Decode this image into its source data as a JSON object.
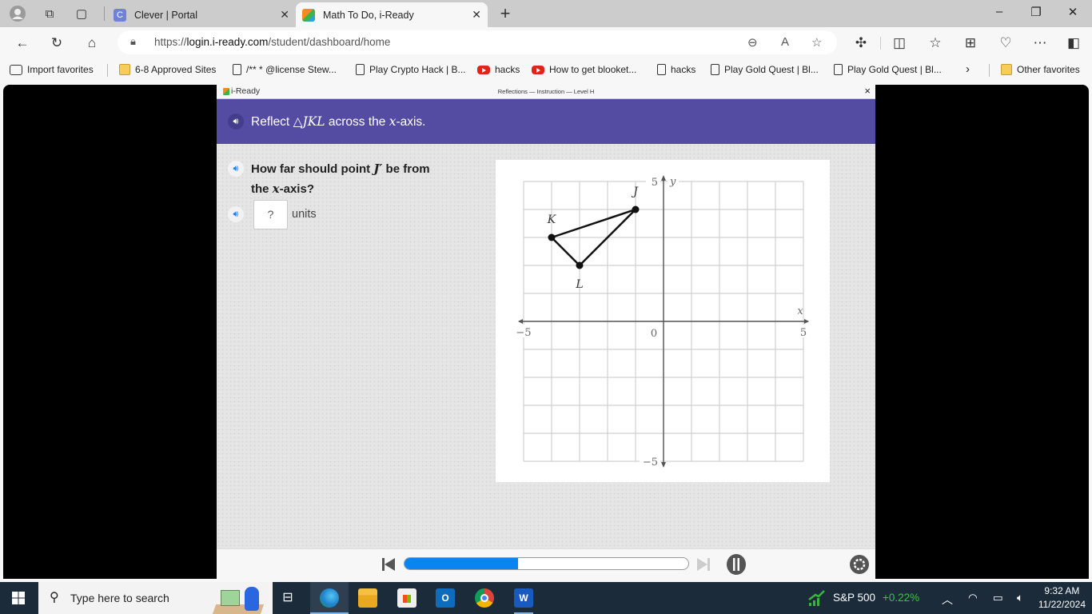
{
  "browser": {
    "tabs": [
      {
        "title": "Clever | Portal",
        "favicon": "clever-icon",
        "active": false
      },
      {
        "title": "Math To Do, i-Ready",
        "favicon": "iready-icon",
        "active": true
      }
    ],
    "url_prefix": "https://",
    "url_domain": "login.i-ready.com",
    "url_path": "/student/dashboard/home",
    "favorites": [
      {
        "label": "Import favorites",
        "icon": "import-icon"
      },
      {
        "label": "6-8 Approved Sites",
        "icon": "folder-icon"
      },
      {
        "label": "/** * @license Stew...",
        "icon": "page-icon"
      },
      {
        "label": "Play Crypto Hack | B...",
        "icon": "page-icon"
      },
      {
        "label": "hacks",
        "icon": "youtube-icon"
      },
      {
        "label": "How to get blooket...",
        "icon": "youtube-icon"
      },
      {
        "label": "hacks",
        "icon": "page-icon"
      },
      {
        "label": "Play Gold Quest | Bl...",
        "icon": "page-icon"
      },
      {
        "label": "Play Gold Quest | Bl...",
        "icon": "page-icon"
      }
    ],
    "other_favorites": "Other favorites"
  },
  "app": {
    "logo": "i-Ready",
    "lesson_title": "Reflections — Instruction — Level H",
    "close": "×",
    "banner": {
      "pre": "Reflect ",
      "math": "△JKL",
      "mid": " across the ",
      "axis": "x",
      "post": "-axis."
    },
    "question": {
      "line1_pre": "How far should point ",
      "point": "J′",
      "line1_post": " be from",
      "line2_pre": "the ",
      "axis": "x",
      "line2_post": "-axis?"
    },
    "answer_placeholder": "?",
    "answer_unit": "units",
    "progress_fraction": 0.4
  },
  "chart_data": {
    "type": "scatter",
    "title": "",
    "xlabel": "x",
    "ylabel": "y",
    "xlim": [
      -5,
      5
    ],
    "ylim": [
      -5,
      5
    ],
    "grid": true,
    "tick_labels": {
      "x_min": "−5",
      "x_max": "5",
      "origin": "0",
      "y_max": "5",
      "y_min": "−5"
    },
    "points": [
      {
        "label": "J",
        "x": -1,
        "y": 4
      },
      {
        "label": "K",
        "x": -4,
        "y": 3
      },
      {
        "label": "L",
        "x": -3,
        "y": 2
      }
    ],
    "polygon": [
      "J",
      "K",
      "L"
    ]
  },
  "taskbar": {
    "search_placeholder": "Type here to search",
    "stock_name": "S&P 500",
    "stock_change": "+0.22%",
    "time": "9:32 AM",
    "date": "11/22/2024"
  }
}
